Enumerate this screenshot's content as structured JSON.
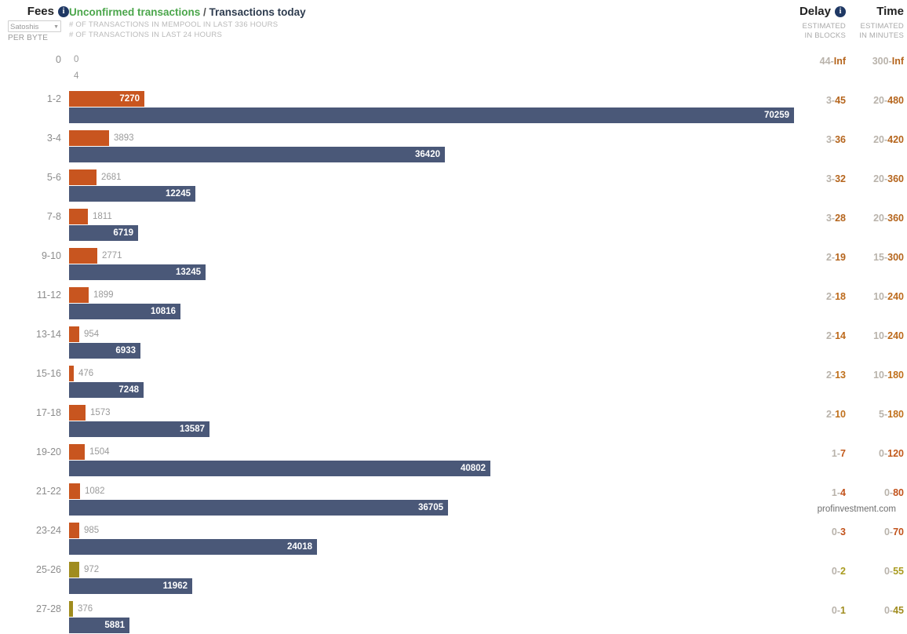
{
  "header": {
    "fees_title": "Fees",
    "fees_info_icon": "info-icon",
    "fee_unit_selected": "Satoshis",
    "fee_unit_caret": "▼",
    "per_byte": "PER BYTE",
    "legend_unconfirmed": "Unconfirmed transactions",
    "legend_separator": " / ",
    "legend_today": "Transactions today",
    "legend_sub1": "# OF TRANSACTIONS IN MEMPOOL IN LAST 336 HOURS",
    "legend_sub2": "# OF TRANSACTIONS IN LAST 24 HOURS",
    "delay_title": "Delay",
    "delay_info_icon": "info-icon",
    "delay_sub1": "ESTIMATED",
    "delay_sub2": "IN BLOCKS",
    "time_title": "Time",
    "time_sub1": "ESTIMATED",
    "time_sub2": "IN MINUTES"
  },
  "colors": {
    "orange": "#c8551f",
    "olive": "#a08c1e",
    "blue": "#4a5878",
    "green": "#4ba64b",
    "value_outside": "#9a9a9a",
    "axis_label": "#8c8c8c"
  },
  "watermark": "profinvestment.com",
  "chart_data": {
    "type": "bar",
    "title": "Unconfirmed transactions / Transactions today",
    "xlabel": "",
    "ylabel": "Fees (Satoshis per byte)",
    "orientation": "horizontal",
    "grouped": true,
    "max_value": 70259,
    "series": [
      {
        "name": "Unconfirmed transactions",
        "sublabel": "# OF TRANSACTIONS IN MEMPOOL IN LAST 336 HOURS",
        "color": "#c8551f"
      },
      {
        "name": "Transactions today",
        "sublabel": "# OF TRANSACTIONS IN LAST 24 HOURS",
        "color": "#4a5878"
      }
    ],
    "categories": [
      "0",
      "1-2",
      "3-4",
      "5-6",
      "7-8",
      "9-10",
      "11-12",
      "13-14",
      "15-16",
      "17-18",
      "19-20",
      "21-22",
      "23-24",
      "25-26",
      "27-28"
    ],
    "rows": [
      {
        "fee": "0",
        "unconfirmed": 0,
        "today": 4,
        "unconfirmed_color": "#c8551f",
        "delay_lo": "44",
        "delay_hi": "Inf",
        "time_lo": "300",
        "time_hi": "Inf",
        "delay_color": "#b5651d",
        "time_color": "#b5651d"
      },
      {
        "fee": "1-2",
        "unconfirmed": 7270,
        "today": 70259,
        "unconfirmed_color": "#c8551f",
        "delay_lo": "3",
        "delay_hi": "45",
        "time_lo": "20",
        "time_hi": "480",
        "delay_color": "#b5651d",
        "time_color": "#b5651d"
      },
      {
        "fee": "3-4",
        "unconfirmed": 3893,
        "today": 36420,
        "unconfirmed_color": "#c8551f",
        "delay_lo": "3",
        "delay_hi": "36",
        "time_lo": "20",
        "time_hi": "420",
        "delay_color": "#b5651d",
        "time_color": "#b5651d"
      },
      {
        "fee": "5-6",
        "unconfirmed": 2681,
        "today": 12245,
        "unconfirmed_color": "#c8551f",
        "delay_lo": "3",
        "delay_hi": "32",
        "time_lo": "20",
        "time_hi": "360",
        "delay_color": "#b5651d",
        "time_color": "#b5651d"
      },
      {
        "fee": "7-8",
        "unconfirmed": 1811,
        "today": 6719,
        "unconfirmed_color": "#c8551f",
        "delay_lo": "3",
        "delay_hi": "28",
        "time_lo": "20",
        "time_hi": "360",
        "delay_color": "#b5651d",
        "time_color": "#b5651d"
      },
      {
        "fee": "9-10",
        "unconfirmed": 2771,
        "today": 13245,
        "unconfirmed_color": "#c8551f",
        "delay_lo": "2",
        "delay_hi": "19",
        "time_lo": "15",
        "time_hi": "300",
        "delay_color": "#b5651d",
        "time_color": "#b5651d"
      },
      {
        "fee": "11-12",
        "unconfirmed": 1899,
        "today": 10816,
        "unconfirmed_color": "#c8551f",
        "delay_lo": "2",
        "delay_hi": "18",
        "time_lo": "10",
        "time_hi": "240",
        "delay_color": "#bd6a1c",
        "time_color": "#bd6a1c"
      },
      {
        "fee": "13-14",
        "unconfirmed": 954,
        "today": 6933,
        "unconfirmed_color": "#c8551f",
        "delay_lo": "2",
        "delay_hi": "14",
        "time_lo": "10",
        "time_hi": "240",
        "delay_color": "#bd6a1c",
        "time_color": "#bd6a1c"
      },
      {
        "fee": "15-16",
        "unconfirmed": 476,
        "today": 7248,
        "unconfirmed_color": "#c8551f",
        "delay_lo": "2",
        "delay_hi": "13",
        "time_lo": "10",
        "time_hi": "180",
        "delay_color": "#c0701c",
        "time_color": "#c0701c"
      },
      {
        "fee": "17-18",
        "unconfirmed": 1573,
        "today": 13587,
        "unconfirmed_color": "#c8551f",
        "delay_lo": "2",
        "delay_hi": "10",
        "time_lo": "5",
        "time_hi": "180",
        "delay_color": "#c0701c",
        "time_color": "#c0701c"
      },
      {
        "fee": "19-20",
        "unconfirmed": 1504,
        "today": 40802,
        "unconfirmed_color": "#c8551f",
        "delay_lo": "1",
        "delay_hi": "7",
        "time_lo": "0",
        "time_hi": "120",
        "delay_color": "#c25a1c",
        "time_color": "#c25a1c"
      },
      {
        "fee": "21-22",
        "unconfirmed": 1082,
        "today": 36705,
        "unconfirmed_color": "#c8551f",
        "delay_lo": "1",
        "delay_hi": "4",
        "time_lo": "0",
        "time_hi": "80",
        "delay_color": "#c2531c",
        "time_color": "#c2531c"
      },
      {
        "fee": "23-24",
        "unconfirmed": 985,
        "today": 24018,
        "unconfirmed_color": "#c8551f",
        "delay_lo": "0",
        "delay_hi": "3",
        "time_lo": "0",
        "time_hi": "70",
        "delay_color": "#c2531c",
        "time_color": "#c2531c"
      },
      {
        "fee": "25-26",
        "unconfirmed": 972,
        "today": 11962,
        "unconfirmed_color": "#a08c1e",
        "delay_lo": "0",
        "delay_hi": "2",
        "time_lo": "0",
        "time_hi": "55",
        "delay_color": "#a99b1f",
        "time_color": "#a99b1f"
      },
      {
        "fee": "27-28",
        "unconfirmed": 376,
        "today": 5881,
        "unconfirmed_color": "#a08c1e",
        "delay_lo": "0",
        "delay_hi": "1",
        "time_lo": "0",
        "time_hi": "45",
        "delay_color": "#a08c1e",
        "time_color": "#a08c1e"
      }
    ]
  }
}
